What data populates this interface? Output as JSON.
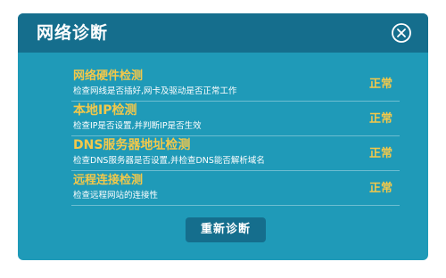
{
  "dialog": {
    "title": "网络诊断",
    "close_icon": "close-circle-icon",
    "rows": [
      {
        "title": "网络硬件检测",
        "desc": "检查网线是否插好,网卡及驱动是否正常工作",
        "status": "正常"
      },
      {
        "title": "本地IP检测",
        "desc": "检查IP是否设置,并判断IP是否生效",
        "status": "正常"
      },
      {
        "title": "DNS服务器地址检测",
        "desc": "检查DNS服务器是否设置,并检查DNS能否解析域名",
        "status": "正常"
      },
      {
        "title": "远程连接检测",
        "desc": "检查远程网站的连接性",
        "status": "正常"
      }
    ],
    "rediagnose_label": "重新诊断"
  },
  "colors": {
    "dialog_body": "#1f9ab8",
    "titlebar": "#156e8d",
    "accent": "#f3c84a",
    "text": "#ffffff"
  }
}
